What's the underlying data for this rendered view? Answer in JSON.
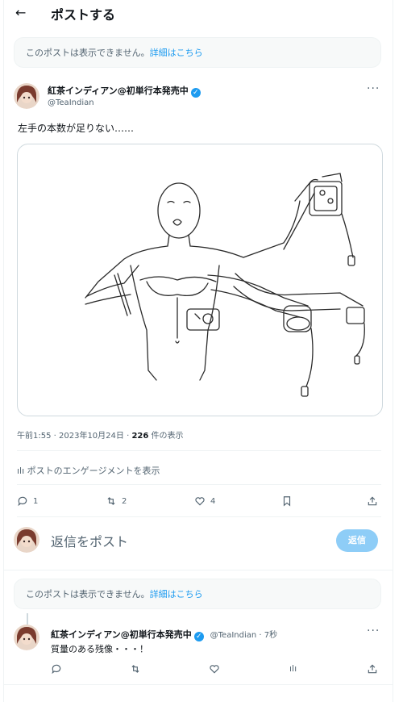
{
  "header": {
    "back_icon": "←",
    "title": "ポストする"
  },
  "notice1": {
    "text": "このポストは表示できません。",
    "link": "詳細はこちら"
  },
  "post": {
    "author": "紅茶インディアン@初単行本発売中",
    "handle": "@TeaIndian",
    "text": "左手の本数が足りない……",
    "image_alt": "sketch of a figure with multiple arms holding game controllers",
    "time": "午前1:55 · 2023年10月24日 · ",
    "views_count": "226",
    "views_label": " 件の表示",
    "analytics_label": "ポストのエンゲージメントを表示",
    "actions": {
      "replies": "1",
      "reposts": "2",
      "likes": "4"
    }
  },
  "reply_box": {
    "placeholder": "返信をポスト",
    "button": "返信"
  },
  "notice2": {
    "text": "このポストは表示できません。",
    "link": "詳細はこちら"
  },
  "reply": {
    "author": "紅茶インディアン@初単行本発売中",
    "handle": "@TeaIndian · 7秒",
    "text": "質量のある残像・・・！"
  },
  "colors": {
    "accent": "#1d9bf0",
    "reply_button": "#8ecdf7",
    "muted": "#536471"
  }
}
